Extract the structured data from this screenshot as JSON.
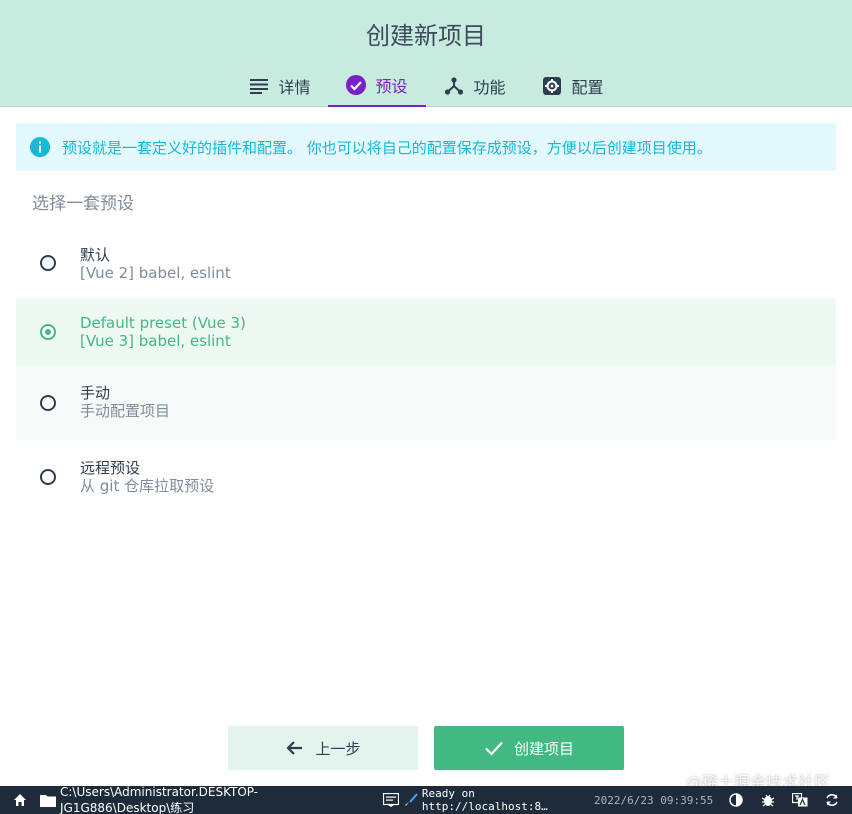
{
  "header": {
    "title": "创建新项目",
    "tabs": [
      {
        "label": "详情",
        "icon": "list-icon"
      },
      {
        "label": "预设",
        "icon": "check-circle-icon",
        "active": true
      },
      {
        "label": "功能",
        "icon": "fork-icon"
      },
      {
        "label": "配置",
        "icon": "gear-icon"
      }
    ]
  },
  "banner": {
    "text": "预设就是一套定义好的插件和配置。 你也可以将自己的配置保存成预设，方便以后创建项目使用。",
    "icon": "info-icon"
  },
  "section_title": "选择一套预设",
  "options": [
    {
      "name": "默认",
      "desc": "[Vue 2] babel, eslint",
      "selected": false
    },
    {
      "name": "Default preset (Vue 3)",
      "desc": "[Vue 3] babel, eslint",
      "selected": true
    },
    {
      "name": "手动",
      "desc": "手动配置项目",
      "selected": false
    },
    {
      "name": "远程预设",
      "desc": "从 git 仓库拉取预设",
      "selected": false
    }
  ],
  "buttons": {
    "prev_label": "上一步",
    "create_label": "创建项目"
  },
  "watermark": "@稀土掘金技术社区",
  "statusbar": {
    "path": "C:\\Users\\Administrator.DESKTOP-JG1G886\\Desktop\\练习",
    "log": "Ready on http://localhost:8…",
    "timestamp": "2022/6/23 09:39:55"
  },
  "colors": {
    "accent": "#42b983",
    "header_bg": "#c8ebe0",
    "active_tab": "#7b1fcc",
    "info": "#17b8d8",
    "statusbar_bg": "#1e2b3a"
  }
}
